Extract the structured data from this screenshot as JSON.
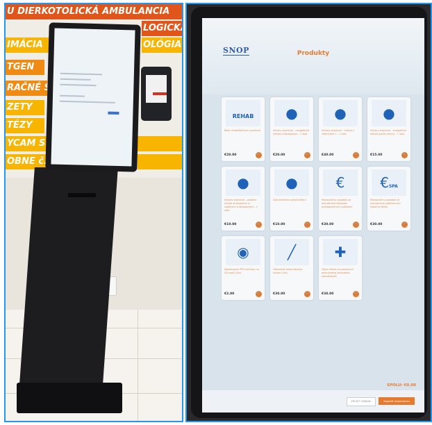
{
  "left_photo": {
    "signs": [
      "U DIERKOTOLICKÁ AMBULANCIA",
      "LOGICKÁ AM",
      "IMÁCIA",
      "OLÓGIA",
      "TGEN",
      "RAČNÉ SA",
      "ZETY",
      "TÉZY",
      "YCAM SK",
      "OBNE č."
    ]
  },
  "screen": {
    "logo": "SNOP",
    "title": "Produkty",
    "products": [
      {
        "icon": "rehab-icon",
        "icon_text": "REHAB",
        "text": "Balík rehabilitačných pomôcok",
        "price": "€20.00"
      },
      {
        "icon": "patient-drip-icon",
        "icon_text": "",
        "text": "Infúzny stacionár - analgetická infúzia s Novalginom - 1 ráaz",
        "price": "€20.00"
      },
      {
        "icon": "patient-drip-c-icon",
        "icon_text": "",
        "text": "Infúzny stacionár - infúzia s vitamínom C - 1 ráaz",
        "price": "€40.00"
      },
      {
        "icon": "patient-clipboard-icon",
        "icon_text": "",
        "text": "Infúzny stacionár - analgetická infúzia podľa zmluvy - 1 ráaz",
        "price": "€15.00"
      },
      {
        "icon": "patient-drip-icon",
        "icon_text": "",
        "text": "Infúzny stacionár - podanie infúzie ambulantne (s vlastnými a liekapovými) - 1 ráaz",
        "price": "€10.00"
      },
      {
        "icon": "patient-scan-icon",
        "icon_text": "",
        "text": "Dokumentácia pohyb lekára",
        "price": "€10.00"
      },
      {
        "icon": "euro-document-icon",
        "icon_text": "",
        "text": "Manipulačný poplatok za manažment dokladov predoperačných vyšetrení",
        "price": "€30.00"
      },
      {
        "icon": "euro-spa-document-icon",
        "icon_text": "SPA",
        "text": "Manipulačný poplatok za manažment vyšetrení pre kúpeľnú liečbu",
        "price": "€30.00"
      },
      {
        "icon": "xray-cd-icon",
        "icon_text": "",
        "text": "Napaľovanie RTG snímkov na CD nosič (1ks)",
        "price": "€2.00"
      },
      {
        "icon": "syringe-icon",
        "icon_text": "",
        "text": "Očkovanie jednorázovým kusom (1ks)",
        "price": "€30.00"
      },
      {
        "icon": "doctor-patient-icon",
        "icon_text": "",
        "text": "Výber lekára pri poskytnutí ambulantnej zdravotnej starostlivosti",
        "price": "€30.00"
      }
    ],
    "total": "SPOLU: €0.00",
    "cancel_label": "ZRUŠIŤ OBJEDN.",
    "pay_label": "Zaplatiť objednávku"
  },
  "colors": {
    "accent": "#e57a2f",
    "icon_blue": "#1f63b8",
    "frame": "#2196f3"
  }
}
